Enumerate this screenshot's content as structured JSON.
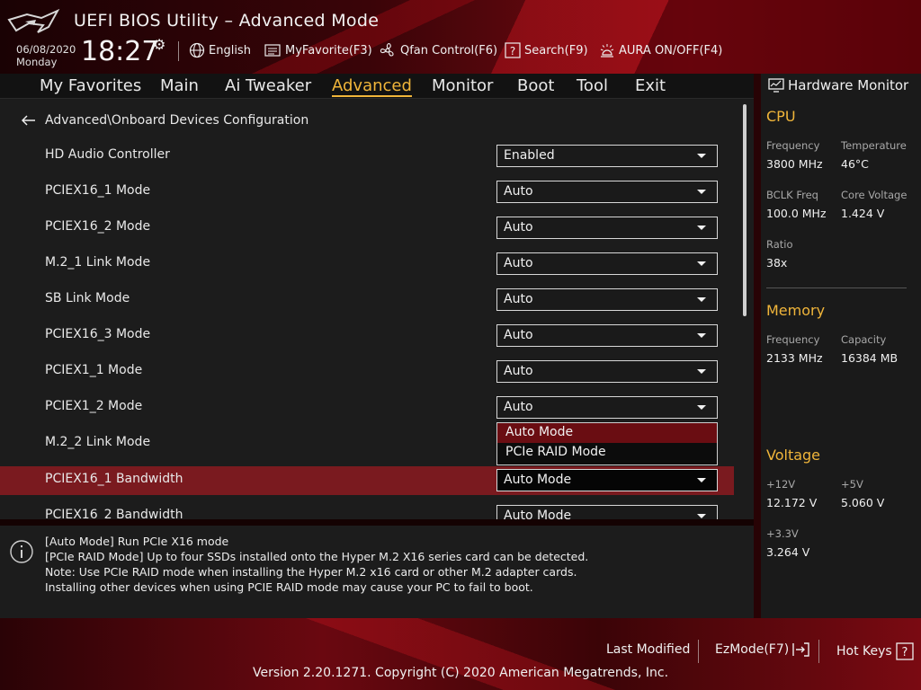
{
  "header": {
    "title": "UEFI BIOS Utility – Advanced Mode",
    "date": "06/08/2020",
    "day": "Monday",
    "time": "18:27",
    "tools": [
      {
        "label": "English",
        "icon": "globe-icon"
      },
      {
        "label": "MyFavorite(F3)",
        "icon": "favorite-list-icon"
      },
      {
        "label": "Qfan Control(F6)",
        "icon": "fan-icon"
      },
      {
        "label": "Search(F9)",
        "icon": "search-help-icon"
      },
      {
        "label": "AURA ON/OFF(F4)",
        "icon": "aura-light-icon"
      }
    ]
  },
  "menu": {
    "items": [
      "My Favorites",
      "Main",
      "Ai Tweaker",
      "Advanced",
      "Monitor",
      "Boot",
      "Tool",
      "Exit"
    ],
    "active": "Advanced"
  },
  "breadcrumb": "Advanced\\Onboard Devices Configuration",
  "settings": [
    {
      "label": "HD Audio Controller",
      "value": "Enabled"
    },
    {
      "label": "PCIEX16_1 Mode",
      "value": "Auto"
    },
    {
      "label": "PCIEX16_2 Mode",
      "value": "Auto"
    },
    {
      "label": "M.2_1 Link Mode",
      "value": "Auto"
    },
    {
      "label": "SB Link Mode",
      "value": "Auto"
    },
    {
      "label": "PCIEX16_3 Mode",
      "value": "Auto"
    },
    {
      "label": "PCIEX1_1 Mode",
      "value": "Auto"
    },
    {
      "label": "PCIEX1_2 Mode",
      "value": "Auto"
    },
    {
      "label": "M.2_2 Link Mode",
      "value": ""
    },
    {
      "label": "PCIEX16_1 Bandwidth",
      "value": "Auto Mode"
    },
    {
      "label": "PCIEX16_2 Bandwidth",
      "value": "Auto Mode"
    }
  ],
  "dropdown_options": [
    "Auto Mode",
    "PCIe RAID Mode"
  ],
  "help": {
    "lines": [
      "[Auto Mode] Run PCIe X16 mode",
      "[PCIe RAID Mode] Up to four SSDs installed onto the Hyper M.2 X16 series card can be detected.",
      "Note: Use PCIe RAID mode when installing the Hyper M.2 x16 card or other M.2 adapter cards.",
      "Installing other devices when using PCIE RAID mode may cause your PC to fail to boot."
    ]
  },
  "hardware_monitor": {
    "title": "Hardware Monitor",
    "cpu": {
      "heading": "CPU",
      "frequency_label": "Frequency",
      "frequency": "3800 MHz",
      "temperature_label": "Temperature",
      "temperature": "46°C",
      "bclk_label": "BCLK Freq",
      "bclk": "100.0 MHz",
      "core_voltage_label": "Core Voltage",
      "core_voltage": "1.424 V",
      "ratio_label": "Ratio",
      "ratio": "38x"
    },
    "memory": {
      "heading": "Memory",
      "frequency_label": "Frequency",
      "frequency": "2133 MHz",
      "capacity_label": "Capacity",
      "capacity": "16384 MB"
    },
    "voltage": {
      "heading": "Voltage",
      "v12_label": "+12V",
      "v12": "12.172 V",
      "v5_label": "+5V",
      "v5": "5.060 V",
      "v33_label": "+3.3V",
      "v33": "3.264 V"
    }
  },
  "footer": {
    "last_modified": "Last Modified",
    "ezmode": "EzMode(F7)",
    "hotkeys": "Hot Keys",
    "version": "Version 2.20.1271. Copyright (C) 2020 American Megatrends, Inc."
  },
  "colors": {
    "accent": "#f0b53a",
    "selected_row": "#7a1a1f",
    "highlight_option": "#6a0d12"
  }
}
